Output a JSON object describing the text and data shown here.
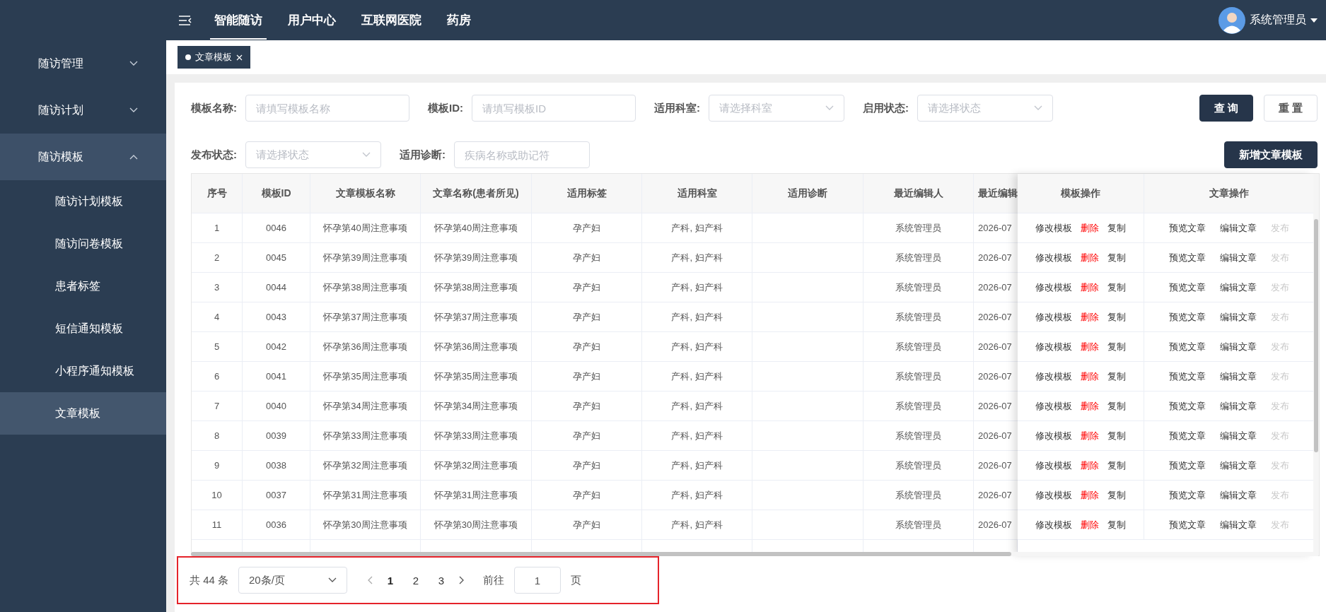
{
  "top_nav": {
    "tabs": [
      {
        "label": "智能随访",
        "selected": true
      },
      {
        "label": "用户中心",
        "selected": false
      },
      {
        "label": "互联网医院",
        "selected": false
      },
      {
        "label": "药房",
        "selected": false
      }
    ],
    "user": {
      "name": "系统管理员"
    }
  },
  "sidebar": {
    "items": [
      {
        "label": "随访管理",
        "expanded": false,
        "selected": false
      },
      {
        "label": "随访计划",
        "expanded": false,
        "selected": false
      },
      {
        "label": "随访模板",
        "expanded": true,
        "selected": true,
        "children": [
          {
            "label": "随访计划模板",
            "selected": false
          },
          {
            "label": "随访问卷模板",
            "selected": false
          },
          {
            "label": "患者标签",
            "selected": false
          },
          {
            "label": "短信通知模板",
            "selected": false
          },
          {
            "label": "小程序通知模板",
            "selected": false
          },
          {
            "label": "文章模板",
            "selected": true
          }
        ]
      }
    ]
  },
  "open_tabs": [
    {
      "label": "文章模板",
      "selected": true
    }
  ],
  "filters": [
    {
      "label": "模板名称:",
      "placeholder": "请填写模板名称",
      "kind": "text"
    },
    {
      "label": "模板ID:",
      "placeholder": "请填写模板ID",
      "kind": "text"
    },
    {
      "label": "适用科室:",
      "placeholder": "请选择科室",
      "kind": "select"
    },
    {
      "label": "启用状态:",
      "placeholder": "请选择状态",
      "kind": "select"
    },
    {
      "label": "发布状态:",
      "placeholder": "请选择状态",
      "kind": "select"
    },
    {
      "label": "适用诊断:",
      "placeholder": "疾病名称或助记符",
      "kind": "text"
    }
  ],
  "buttons": {
    "query": "查 询",
    "reset": "重 置",
    "add": "新增文章模板"
  },
  "table": {
    "columns": [
      "序号",
      "模板ID",
      "文章模板名称",
      "文章名称(患者所见)",
      "适用标签",
      "适用科室",
      "适用诊断",
      "最近编辑人",
      "最近编辑"
    ],
    "action_columns": [
      "模板操作",
      "文章操作"
    ],
    "rows": [
      {
        "index": "1",
        "template_id": "0046",
        "template_name": "怀孕第40周注意事项",
        "article_name": "怀孕第40周注意事项",
        "tag": "孕产妇",
        "department": "产科, 妇产科",
        "editor": "系统管理员",
        "edited": "2026-07",
        "template_actions": [
          {
            "label": "修改模板",
            "kind": "link"
          },
          {
            "label": "删除",
            "kind": "danger"
          },
          {
            "label": "复制",
            "kind": "link"
          }
        ],
        "article_actions": [
          {
            "label": "预览文章",
            "disabled": false
          },
          {
            "label": "编辑文章",
            "disabled": false
          },
          {
            "label": "发布",
            "disabled": true
          }
        ]
      },
      {
        "index": "2",
        "template_id": "0045",
        "template_name": "怀孕第39周注意事项",
        "article_name": "怀孕第39周注意事项",
        "tag": "孕产妇",
        "department": "产科, 妇产科",
        "editor": "系统管理员",
        "edited": "2026-07",
        "template_actions": [
          {
            "label": "修改模板",
            "kind": "link"
          },
          {
            "label": "删除",
            "kind": "danger"
          },
          {
            "label": "复制",
            "kind": "link"
          }
        ],
        "article_actions": [
          {
            "label": "预览文章",
            "disabled": false
          },
          {
            "label": "编辑文章",
            "disabled": false
          },
          {
            "label": "发布",
            "disabled": true
          }
        ]
      },
      {
        "index": "3",
        "template_id": "0044",
        "template_name": "怀孕第38周注意事项",
        "article_name": "怀孕第38周注意事项",
        "tag": "孕产妇",
        "department": "产科, 妇产科",
        "editor": "系统管理员",
        "edited": "2026-07",
        "template_actions": [
          {
            "label": "修改模板",
            "kind": "link"
          },
          {
            "label": "删除",
            "kind": "danger"
          },
          {
            "label": "复制",
            "kind": "link"
          }
        ],
        "article_actions": [
          {
            "label": "预览文章",
            "disabled": false
          },
          {
            "label": "编辑文章",
            "disabled": false
          },
          {
            "label": "发布",
            "disabled": true
          }
        ]
      },
      {
        "index": "4",
        "template_id": "0043",
        "template_name": "怀孕第37周注意事项",
        "article_name": "怀孕第37周注意事项",
        "tag": "孕产妇",
        "department": "产科, 妇产科",
        "editor": "系统管理员",
        "edited": "2026-07",
        "template_actions": [
          {
            "label": "修改模板",
            "kind": "link"
          },
          {
            "label": "删除",
            "kind": "danger"
          },
          {
            "label": "复制",
            "kind": "link"
          }
        ],
        "article_actions": [
          {
            "label": "预览文章",
            "disabled": false
          },
          {
            "label": "编辑文章",
            "disabled": false
          },
          {
            "label": "发布",
            "disabled": true
          }
        ]
      },
      {
        "index": "5",
        "template_id": "0042",
        "template_name": "怀孕第36周注意事项",
        "article_name": "怀孕第36周注意事项",
        "tag": "孕产妇",
        "department": "产科, 妇产科",
        "editor": "系统管理员",
        "edited": "2026-07",
        "template_actions": [
          {
            "label": "修改模板",
            "kind": "link"
          },
          {
            "label": "删除",
            "kind": "danger"
          },
          {
            "label": "复制",
            "kind": "link"
          }
        ],
        "article_actions": [
          {
            "label": "预览文章",
            "disabled": false
          },
          {
            "label": "编辑文章",
            "disabled": false
          },
          {
            "label": "发布",
            "disabled": true
          }
        ]
      },
      {
        "index": "6",
        "template_id": "0041",
        "template_name": "怀孕第35周注意事项",
        "article_name": "怀孕第35周注意事项",
        "tag": "孕产妇",
        "department": "产科, 妇产科",
        "editor": "系统管理员",
        "edited": "2026-07",
        "template_actions": [
          {
            "label": "修改模板",
            "kind": "link"
          },
          {
            "label": "删除",
            "kind": "danger"
          },
          {
            "label": "复制",
            "kind": "link"
          }
        ],
        "article_actions": [
          {
            "label": "预览文章",
            "disabled": false
          },
          {
            "label": "编辑文章",
            "disabled": false
          },
          {
            "label": "发布",
            "disabled": true
          }
        ]
      },
      {
        "index": "7",
        "template_id": "0040",
        "template_name": "怀孕第34周注意事项",
        "article_name": "怀孕第34周注意事项",
        "tag": "孕产妇",
        "department": "产科, 妇产科",
        "editor": "系统管理员",
        "edited": "2026-07",
        "template_actions": [
          {
            "label": "修改模板",
            "kind": "link"
          },
          {
            "label": "删除",
            "kind": "danger"
          },
          {
            "label": "复制",
            "kind": "link"
          }
        ],
        "article_actions": [
          {
            "label": "预览文章",
            "disabled": false
          },
          {
            "label": "编辑文章",
            "disabled": false
          },
          {
            "label": "发布",
            "disabled": true
          }
        ]
      },
      {
        "index": "8",
        "template_id": "0039",
        "template_name": "怀孕第33周注意事项",
        "article_name": "怀孕第33周注意事项",
        "tag": "孕产妇",
        "department": "产科, 妇产科",
        "editor": "系统管理员",
        "edited": "2026-07",
        "template_actions": [
          {
            "label": "修改模板",
            "kind": "link"
          },
          {
            "label": "删除",
            "kind": "danger"
          },
          {
            "label": "复制",
            "kind": "link"
          }
        ],
        "article_actions": [
          {
            "label": "预览文章",
            "disabled": false
          },
          {
            "label": "编辑文章",
            "disabled": false
          },
          {
            "label": "发布",
            "disabled": true
          }
        ]
      },
      {
        "index": "9",
        "template_id": "0038",
        "template_name": "怀孕第32周注意事项",
        "article_name": "怀孕第32周注意事项",
        "tag": "孕产妇",
        "department": "产科, 妇产科",
        "editor": "系统管理员",
        "edited": "2026-07",
        "template_actions": [
          {
            "label": "修改模板",
            "kind": "link"
          },
          {
            "label": "删除",
            "kind": "danger"
          },
          {
            "label": "复制",
            "kind": "link"
          }
        ],
        "article_actions": [
          {
            "label": "预览文章",
            "disabled": false
          },
          {
            "label": "编辑文章",
            "disabled": false
          },
          {
            "label": "发布",
            "disabled": true
          }
        ]
      },
      {
        "index": "10",
        "template_id": "0037",
        "template_name": "怀孕第31周注意事项",
        "article_name": "怀孕第31周注意事项",
        "tag": "孕产妇",
        "department": "产科, 妇产科",
        "editor": "系统管理员",
        "edited": "2026-07",
        "template_actions": [
          {
            "label": "修改模板",
            "kind": "link"
          },
          {
            "label": "删除",
            "kind": "danger"
          },
          {
            "label": "复制",
            "kind": "link"
          }
        ],
        "article_actions": [
          {
            "label": "预览文章",
            "disabled": false
          },
          {
            "label": "编辑文章",
            "disabled": false
          },
          {
            "label": "发布",
            "disabled": true
          }
        ]
      },
      {
        "index": "11",
        "template_id": "0036",
        "template_name": "怀孕第30周注意事项",
        "article_name": "怀孕第30周注意事项",
        "tag": "孕产妇",
        "department": "产科, 妇产科",
        "editor": "系统管理员",
        "edited": "2026-07",
        "template_actions": [
          {
            "label": "修改模板",
            "kind": "link"
          },
          {
            "label": "删除",
            "kind": "danger"
          },
          {
            "label": "复制",
            "kind": "link"
          }
        ],
        "article_actions": [
          {
            "label": "预览文章",
            "disabled": false
          },
          {
            "label": "编辑文章",
            "disabled": false
          },
          {
            "label": "发布",
            "disabled": true
          }
        ]
      }
    ]
  },
  "pagination": {
    "total": "共 44 条",
    "page_size": "20条/页",
    "pages": [
      {
        "label": "1",
        "selected": true
      },
      {
        "label": "2",
        "selected": false
      },
      {
        "label": "3",
        "selected": false
      }
    ],
    "goto_label": "前往",
    "goto_value": "1",
    "goto_suffix": "页"
  }
}
